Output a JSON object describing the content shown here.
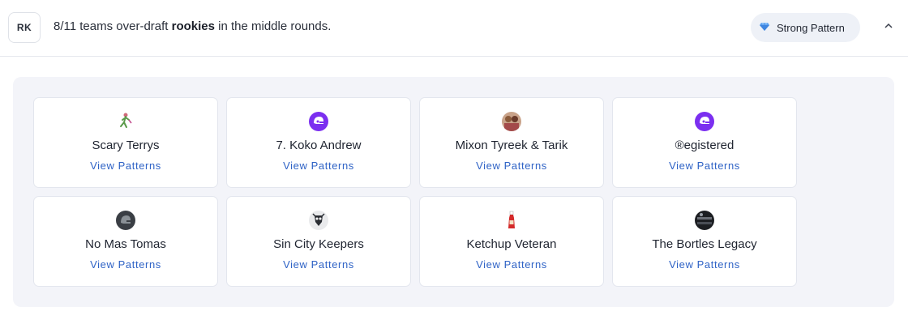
{
  "header": {
    "badge": "RK",
    "summary_prefix": "8/11 teams over-draft ",
    "summary_bold": "rookies",
    "summary_suffix": " in the middle rounds.",
    "pill_label": "Strong Pattern",
    "pill_icon": "diamond-icon",
    "collapse_icon": "chevron-up-icon"
  },
  "teams": [
    {
      "name": "Scary Terrys",
      "link": "View Patterns",
      "avatar": "player-figure-avatar"
    },
    {
      "name": "7. Koko Andrew",
      "link": "View Patterns",
      "avatar": "purple-helmet-avatar"
    },
    {
      "name": "Mixon Tyreek & Tarik",
      "link": "View Patterns",
      "avatar": "players-photo-avatar"
    },
    {
      "name": "®egistered",
      "link": "View Patterns",
      "avatar": "purple-helmet-avatar"
    },
    {
      "name": "No Mas Tomas",
      "link": "View Patterns",
      "avatar": "gray-helmet-avatar"
    },
    {
      "name": "Sin City Keepers",
      "link": "View Patterns",
      "avatar": "skull-logo-avatar"
    },
    {
      "name": "Ketchup Veteran",
      "link": "View Patterns",
      "avatar": "ketchup-bottle-avatar"
    },
    {
      "name": "The Bortles Legacy",
      "link": "View Patterns",
      "avatar": "dark-photo-avatar"
    }
  ],
  "colors": {
    "link": "#2f63c6",
    "panel_bg": "#f3f4f9",
    "pill_bg": "#eef1f7",
    "helmet_purple": "#7b2ff0",
    "diamond": "#5aa0f0"
  }
}
